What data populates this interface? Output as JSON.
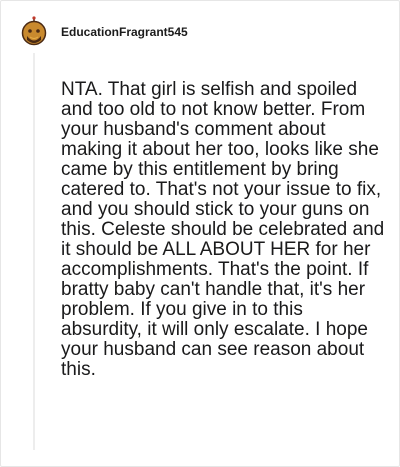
{
  "comment": {
    "username": "EducationFragrant545",
    "avatar_icon": "snoo-avatar-icon",
    "body": "NTA. That girl is selfish and spoiled and too old to not know better. From your husband's comment about making it about her too, looks like she came by this entitlement by bring catered to. That's not your issue to fix, and you should stick to your guns on this. Celeste should be celebrated and it should be ALL ABOUT HER for her accomplishments. That's the point. If bratty baby can't handle that, it's her problem. If you give in to this absurdity, it will only escalate. I hope your husband can see reason about this."
  },
  "colors": {
    "text": "#1a1a1b",
    "thread_line": "#ededed",
    "avatar_primary": "#c98a2e",
    "avatar_dark": "#4a2a14"
  }
}
